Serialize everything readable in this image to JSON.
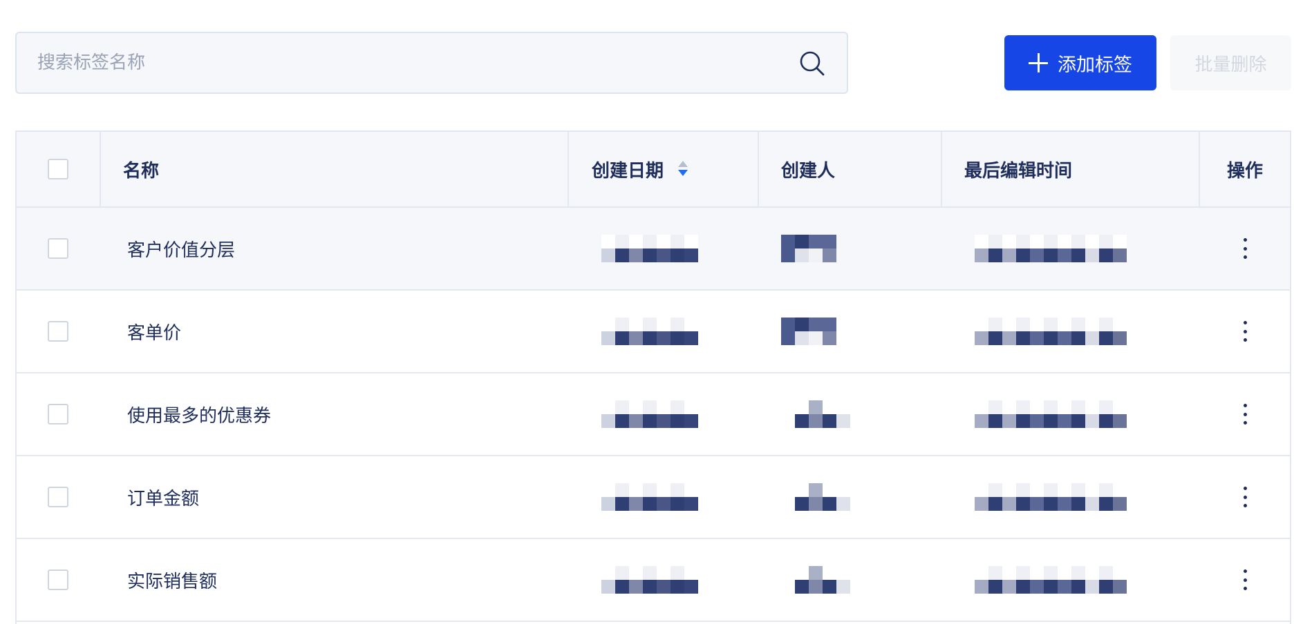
{
  "search": {
    "placeholder": "搜索标签名称"
  },
  "toolbar": {
    "add_label": "添加标签",
    "batch_delete_label": "批量删除"
  },
  "table": {
    "columns": {
      "name": "名称",
      "created_date": "创建日期",
      "creator": "创建人",
      "last_edited": "最后编辑时间",
      "actions": "操作"
    },
    "rows": [
      {
        "name": "客户价值分层"
      },
      {
        "name": "客单价"
      },
      {
        "name": "使用最多的优惠券"
      },
      {
        "name": "订单金额"
      },
      {
        "name": "实际销售额"
      }
    ]
  },
  "colors": {
    "primary": "#1746e6",
    "text": "#1f2d5c",
    "header_bg": "#f5f7fb",
    "sort_active": "#1e6ff0"
  }
}
